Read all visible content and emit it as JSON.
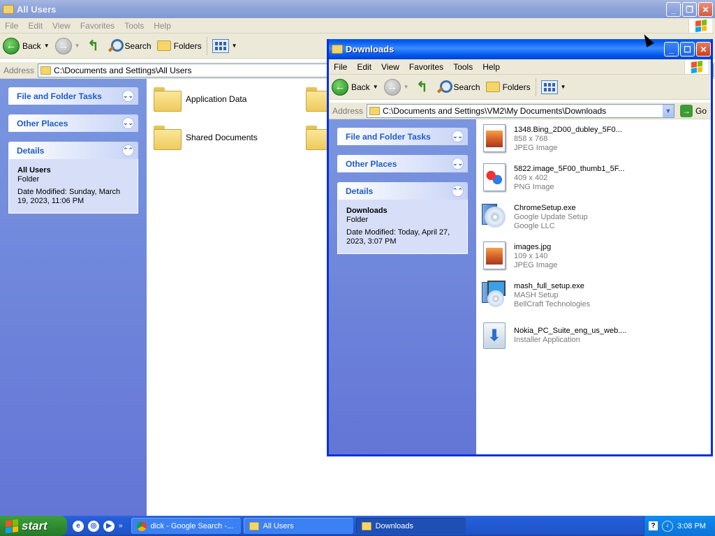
{
  "win1": {
    "title": "All Users",
    "menu": [
      "File",
      "Edit",
      "View",
      "Favorites",
      "Tools",
      "Help"
    ],
    "toolbar": {
      "back": "Back",
      "search": "Search",
      "folders": "Folders"
    },
    "address": {
      "label": "Address",
      "path": "C:\\Documents and Settings\\All Users"
    },
    "panels": {
      "file_tasks": "File and Folder Tasks",
      "other_places": "Other Places",
      "details": "Details"
    },
    "details": {
      "name": "All Users",
      "type": "Folder",
      "modified": "Date Modified: Sunday, March 19, 2023, 11:06 PM"
    },
    "items": [
      "Application Data",
      "Shared Documents"
    ]
  },
  "win2": {
    "title": "Downloads",
    "menu": [
      "File",
      "Edit",
      "View",
      "Favorites",
      "Tools",
      "Help"
    ],
    "toolbar": {
      "back": "Back",
      "search": "Search",
      "folders": "Folders"
    },
    "address": {
      "label": "Address",
      "path": "C:\\Documents and Settings\\VM2\\My Documents\\Downloads",
      "go": "Go"
    },
    "panels": {
      "file_tasks": "File and Folder Tasks",
      "other_places": "Other Places",
      "details": "Details"
    },
    "details": {
      "name": "Downloads",
      "type": "Folder",
      "modified": "Date Modified: Today, April 27, 2023, 3:07 PM"
    },
    "files": [
      {
        "name": "1348.Bing_2D00_dubley_5F0...",
        "l1": "858 x 768",
        "l2": "JPEG Image",
        "icon": "jpeg-file-icon"
      },
      {
        "name": "5822.image_5F00_thumb1_5F...",
        "l1": "409 x 402",
        "l2": "PNG Image",
        "icon": "png-file-icon"
      },
      {
        "name": "ChromeSetup.exe",
        "l1": "Google Update Setup",
        "l2": "Google LLC",
        "icon": "setup-exe-icon"
      },
      {
        "name": "images.jpg",
        "l1": "109 x 140",
        "l2": "JPEG Image",
        "icon": "jpeg-file-icon"
      },
      {
        "name": "mash_full_setup.exe",
        "l1": "MASH Setup",
        "l2": "BellCraft Technologies",
        "icon": "setup-exe-icon"
      },
      {
        "name": "Nokia_PC_Suite_eng_us_web....",
        "l1": "Installer Application",
        "l2": "",
        "icon": "installer-icon"
      }
    ]
  },
  "taskbar": {
    "start": "start",
    "tasks": [
      "dick - Google Search -...",
      "All Users",
      "Downloads"
    ],
    "clock": "3:08 PM"
  }
}
